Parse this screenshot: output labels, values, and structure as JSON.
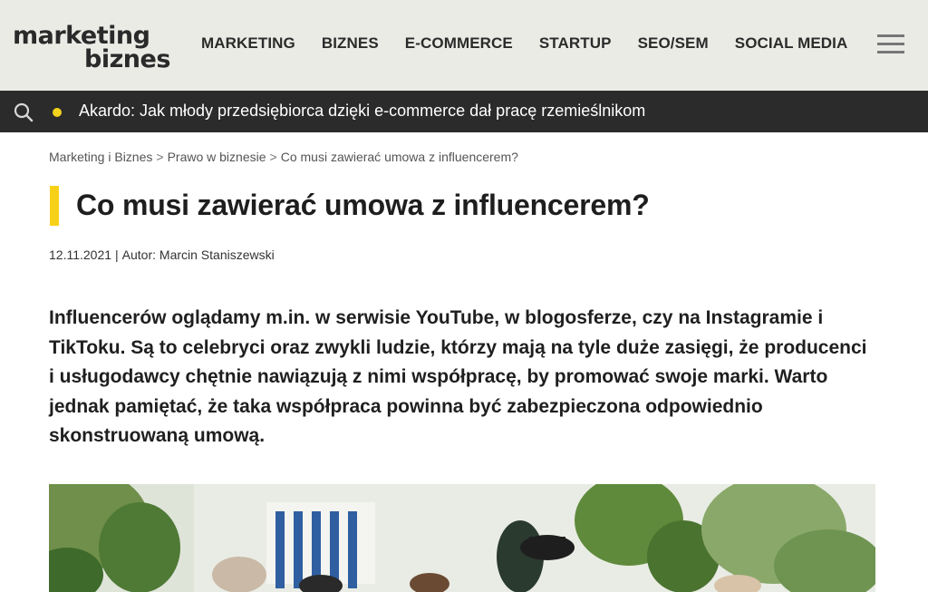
{
  "logo": {
    "line1": "marketing",
    "line2": "biznes"
  },
  "nav": {
    "items": [
      "MARKETING",
      "BIZNES",
      "E-COMMERCE",
      "STARTUP",
      "SEO/SEM",
      "SOCIAL MEDIA"
    ],
    "menu_icon": "hamburger-menu-icon"
  },
  "ticker": {
    "search_icon": "search-icon",
    "accent_color": "#f2d21c",
    "headline": "Akardo: Jak młody przedsiębiorca dzięki e-commerce dał pracę rzemieślnikom"
  },
  "breadcrumb": {
    "items": [
      "Marketing i Biznes",
      "Prawo w biznesie",
      "Co musi zawierać umowa z influencerem?"
    ],
    "separator": ">"
  },
  "article": {
    "title": "Co musi zawierać umowa z influencerem?",
    "date": "12.11.2021",
    "author": "Autor: Marcin Staniszewski",
    "lead": "Influencerów oglądamy m.in. w serwisie YouTube, w blogosferze, czy na Instagramie i TikToku. Są to celebryci oraz zwykli ludzie, którzy mają na tyle duże zasięgi, że producenci i usługodawcy chętnie nawiązują z nimi współpracę, by promować swoje marki. Warto jednak pamiętać, że taka współpraca powinna być zabezpieczona odpowiednio skonstruowaną umową."
  },
  "colors": {
    "brand_yellow": "#f7d117",
    "header_bg": "#ebebe6",
    "ticker_bg": "#2b2b2b"
  }
}
